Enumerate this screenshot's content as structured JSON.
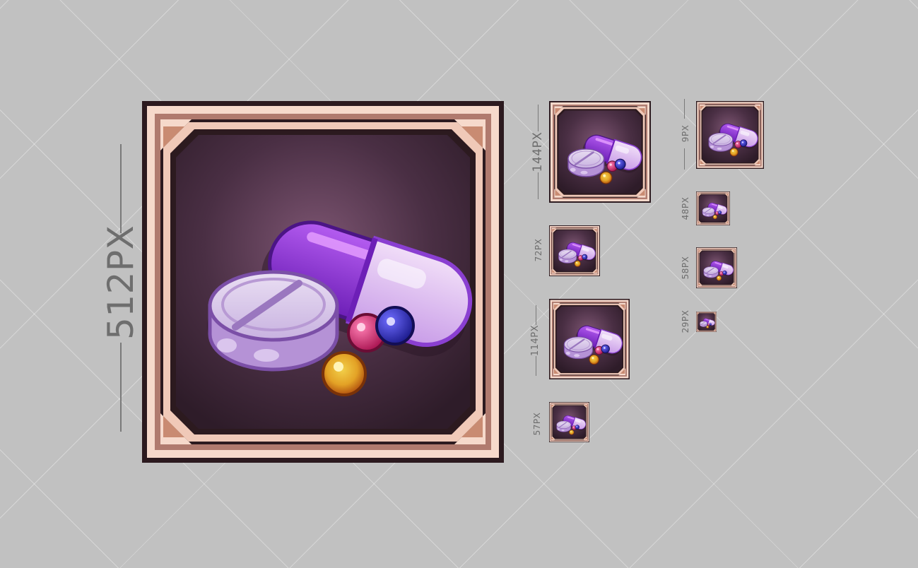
{
  "icon_set": {
    "subject": "pills-and-capsule-icon",
    "colors": {
      "background": "#c1c1c1",
      "frame_dark": "#2c1a1f",
      "frame_light": "#f6d9cb",
      "frame_mid": "#b07a6e",
      "panel": "#3b2535",
      "capsule_purple": "#8a2fd6",
      "capsule_light": "#e7c9f4",
      "tablet": "#d9c6ec",
      "bead_pink": "#d8246a",
      "bead_blue": "#2c2cc9",
      "bead_orange": "#e07a1c"
    },
    "sizes": [
      {
        "id": "icon-512",
        "label": "512PX"
      },
      {
        "id": "icon-144",
        "label": "144PX"
      },
      {
        "id": "icon-72",
        "label": "72PX"
      },
      {
        "id": "icon-114",
        "label": "114PX"
      },
      {
        "id": "icon-57",
        "label": "57PX"
      },
      {
        "id": "icon-96",
        "label": "9PX"
      },
      {
        "id": "icon-48",
        "label": "48PX"
      },
      {
        "id": "icon-58",
        "label": "58PX"
      },
      {
        "id": "icon-29",
        "label": "29PX"
      }
    ]
  }
}
